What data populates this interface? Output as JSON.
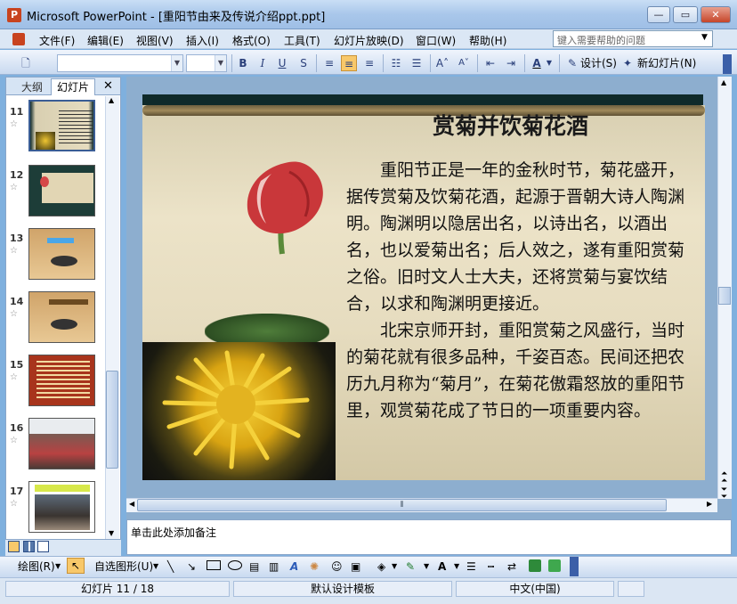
{
  "window": {
    "title": "Microsoft PowerPoint - [重阳节由来及传说介绍ppt.ppt]",
    "app_icon": "P",
    "controls": {
      "minimize": "—",
      "maximize": "▭",
      "close": "✕"
    }
  },
  "menu": {
    "items": [
      "文件(F)",
      "编辑(E)",
      "视图(V)",
      "插入(I)",
      "格式(O)",
      "工具(T)",
      "幻灯片放映(D)",
      "窗口(W)",
      "帮助(H)"
    ],
    "help_placeholder": "键入需要帮助的问题"
  },
  "toolbar": {
    "bold": "B",
    "italic": "I",
    "underline": "U",
    "shadow": "S",
    "font_color": "A",
    "design_label": "设计(S)",
    "new_slide_label": "新幻灯片(N)"
  },
  "left_pane": {
    "tabs": [
      "大纲",
      "幻灯片"
    ],
    "close": "✕",
    "slides": [
      {
        "num": "11",
        "selected": true
      },
      {
        "num": "12",
        "selected": false
      },
      {
        "num": "13",
        "selected": false
      },
      {
        "num": "14",
        "selected": false
      },
      {
        "num": "15",
        "selected": false
      },
      {
        "num": "16",
        "selected": false
      },
      {
        "num": "17",
        "selected": false
      }
    ],
    "star": "☆"
  },
  "slide": {
    "title": "赏菊并饮菊花酒",
    "paragraphs": [
      "重阳节正是一年的金秋时节，菊花盛开，据传赏菊及饮菊花酒，起源于晋朝大诗人陶渊明。陶渊明以隐居出名，以诗出名，以酒出名，也以爱菊出名；后人效之，遂有重阳赏菊之俗。旧时文人士大夫，还将赏菊与宴饮结合，以求和陶渊明更接近。",
      "北宋京师开封，重阳赏菊之风盛行，当时的菊花就有很多品种，千姿百态。民间还把农历九月称为“菊月”，在菊花傲霜怒放的重阳节里，观赏菊花成了节日的一项重要内容。"
    ]
  },
  "notes": {
    "placeholder": "单击此处添加备注"
  },
  "drawing_toolbar": {
    "draw_label": "绘图(R)",
    "autoshapes_label": "自选图形(U)"
  },
  "status": {
    "slide_info": "幻灯片 11 / 18",
    "template": "默认设计模板",
    "language": "中文(中国)"
  }
}
